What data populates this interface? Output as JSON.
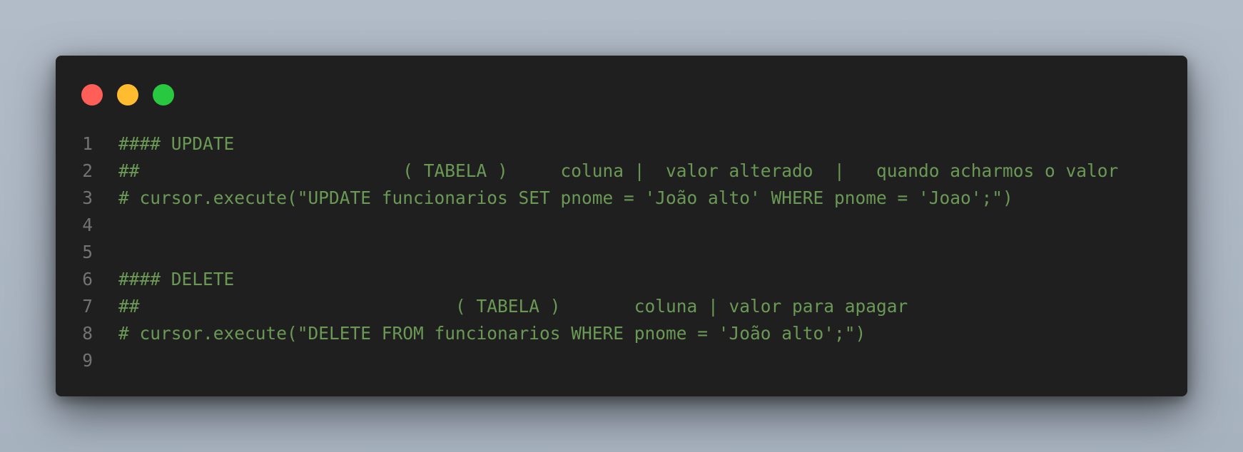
{
  "window": {
    "controls": {
      "close_color": "#ff5f57",
      "minimize_color": "#febc2e",
      "maximize_color": "#28c840"
    }
  },
  "code": {
    "lines": [
      {
        "number": "1",
        "text": "#### UPDATE"
      },
      {
        "number": "2",
        "text": "##                         ( TABELA )     coluna |  valor alterado  |   quando acharmos o valor"
      },
      {
        "number": "3",
        "text": "# cursor.execute(\"UPDATE funcionarios SET pnome = 'João alto' WHERE pnome = 'Joao';\")"
      },
      {
        "number": "4",
        "text": ""
      },
      {
        "number": "5",
        "text": ""
      },
      {
        "number": "6",
        "text": "#### DELETE"
      },
      {
        "number": "7",
        "text": "##                              ( TABELA )       coluna | valor para apagar"
      },
      {
        "number": "8",
        "text": "# cursor.execute(\"DELETE FROM funcionarios WHERE pnome = 'João alto';\")"
      },
      {
        "number": "9",
        "text": ""
      }
    ],
    "comment_color": "#6a9955",
    "line_number_color": "#737373"
  }
}
